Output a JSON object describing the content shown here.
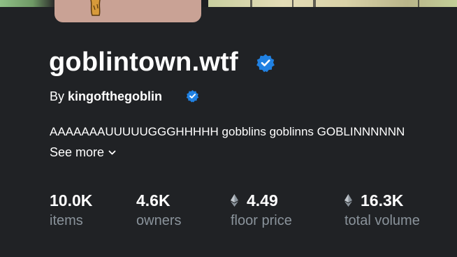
{
  "collection": {
    "title": "goblintown.wtf",
    "by_label": "By",
    "creator": "kingofthegoblin",
    "description": "AAAAAAAUUUUUGGGHHHHH gobblins goblinns GOBLINNNNNN",
    "see_more_label": "See more"
  },
  "stats": [
    {
      "value": "10.0K",
      "label": "items",
      "eth": false
    },
    {
      "value": "4.6K",
      "label": "owners",
      "eth": false
    },
    {
      "value": "4.49",
      "label": "floor price",
      "eth": true
    },
    {
      "value": "16.3K",
      "label": "total volume",
      "eth": true
    }
  ],
  "colors": {
    "background": "#202225",
    "text_primary": "#ffffff",
    "text_secondary": "#8a939b",
    "verified_badge": "#2081e2",
    "avatar_bg": "#c9a295"
  },
  "icons": {
    "verified": "verified-badge-icon",
    "chevron": "chevron-down-icon",
    "eth": "ethereum-icon"
  }
}
